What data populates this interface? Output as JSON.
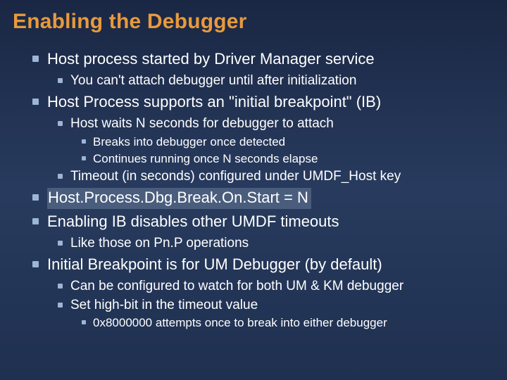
{
  "title": "Enabling the Debugger",
  "b": {
    "p1": "Host process started by Driver Manager service",
    "p1a": "You can't attach debugger until after initialization",
    "p2": "Host Process supports an \"initial breakpoint\" (IB)",
    "p2a": "Host waits N seconds for debugger to attach",
    "p2a1": "Breaks into debugger once detected",
    "p2a2": "Continues running once N seconds elapse",
    "p2b": "Timeout (in seconds) configured under UMDF_Host key",
    "p3": "Host.Process.Dbg.Break.On.Start = N",
    "p4": "Enabling IB disables other UMDF timeouts",
    "p4a": "Like those on Pn.P operations",
    "p5": "Initial Breakpoint is for UM Debugger (by default)",
    "p5a": "Can be configured to watch for both UM & KM debugger",
    "p5b": "Set high-bit in the timeout value",
    "p5b1": "0x8000000 attempts once to break into either debugger"
  }
}
